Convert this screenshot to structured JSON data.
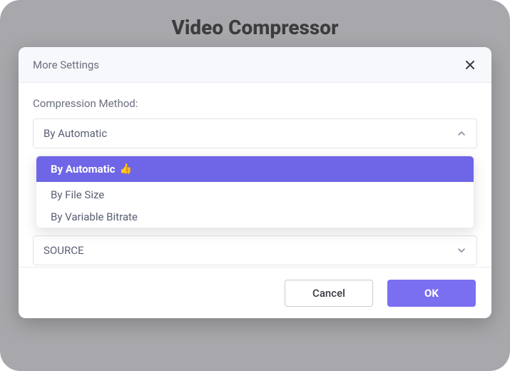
{
  "app": {
    "title": "Video Compressor"
  },
  "modal": {
    "title": "More Settings",
    "field_label": "Compression Method:",
    "method_select": {
      "value": "By Automatic",
      "options": {
        "automatic": "By Automatic",
        "file_size": "By File Size",
        "variable_bitrate": "By Variable Bitrate"
      }
    },
    "source_select": {
      "value": "SOURCE"
    },
    "footer": {
      "cancel": "Cancel",
      "ok": "OK"
    }
  }
}
